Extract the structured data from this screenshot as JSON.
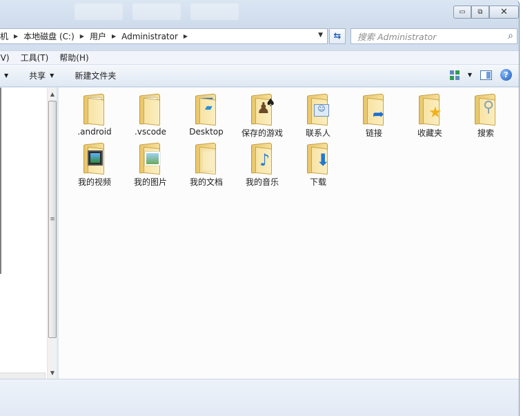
{
  "address": {
    "crumbs": [
      "本地磁盘 (C:)",
      "用户",
      "Administrator"
    ],
    "partial_left": "机"
  },
  "search": {
    "placeholder": "搜索 Administrator"
  },
  "menu": {
    "partial": "(V)",
    "items": [
      "工具(T)",
      "帮助(H)"
    ]
  },
  "commands": {
    "share": "共享",
    "new_folder": "新建文件夹"
  },
  "items": [
    {
      "label": ".android",
      "icon": "folder-doc-icon"
    },
    {
      "label": ".vscode",
      "icon": "folder-doc-icon"
    },
    {
      "label": "Desktop",
      "icon": "folder-desktop-icon"
    },
    {
      "label": "保存的游戏",
      "icon": "folder-games-icon"
    },
    {
      "label": "联系人",
      "icon": "folder-contacts-icon"
    },
    {
      "label": "链接",
      "icon": "folder-links-icon"
    },
    {
      "label": "收藏夹",
      "icon": "folder-favorites-icon"
    },
    {
      "label": "搜索",
      "icon": "folder-search-icon"
    },
    {
      "label": "我的视频",
      "icon": "folder-videos-icon"
    },
    {
      "label": "我的图片",
      "icon": "folder-pictures-icon"
    },
    {
      "label": "我的文档",
      "icon": "folder-documents-icon"
    },
    {
      "label": "我的音乐",
      "icon": "folder-music-icon"
    },
    {
      "label": "下载",
      "icon": "folder-downloads-icon"
    }
  ]
}
